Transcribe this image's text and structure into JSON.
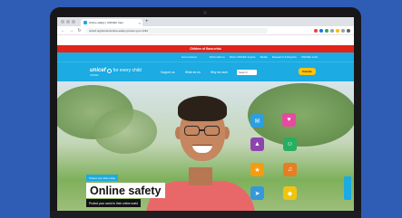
{
  "browser": {
    "tab_title": "Online safety | UNICEF Inter",
    "tab_close": "×",
    "new_tab": "+",
    "nav_back": "←",
    "nav_forward": "→",
    "nav_reload": "↻",
    "url": "unicef.org/stories/online-safety-protect-your-child"
  },
  "alert_bar": {
    "text": "Children of Gaza crisis"
  },
  "utility_nav": {
    "items": [
      "Get involved",
      "Work with us",
      "Work UNICEF Inspire",
      "Media",
      "Research & Reports",
      "UNICEF Jobs"
    ]
  },
  "header": {
    "logo_text": "unicef",
    "tagline": "for every child",
    "logo_subtext": "UNICEF",
    "menu": [
      "Support us",
      "What we do",
      "Why we work"
    ],
    "search_label": "Search",
    "donate_label": "Donate"
  },
  "hero": {
    "eyebrow": "Protect your kids online",
    "title": "Online safety",
    "subtitle": "Protect your world in their online world",
    "icons": [
      "app-icon-1",
      "app-icon-2",
      "app-icon-3",
      "app-icon-4",
      "app-icon-5",
      "app-icon-6",
      "app-icon-7",
      "app-icon-8"
    ]
  },
  "colors": {
    "background": "#2f5cb5",
    "brand": "#1cabe2",
    "alert": "#e2231a",
    "donate": "#ffc20e"
  }
}
